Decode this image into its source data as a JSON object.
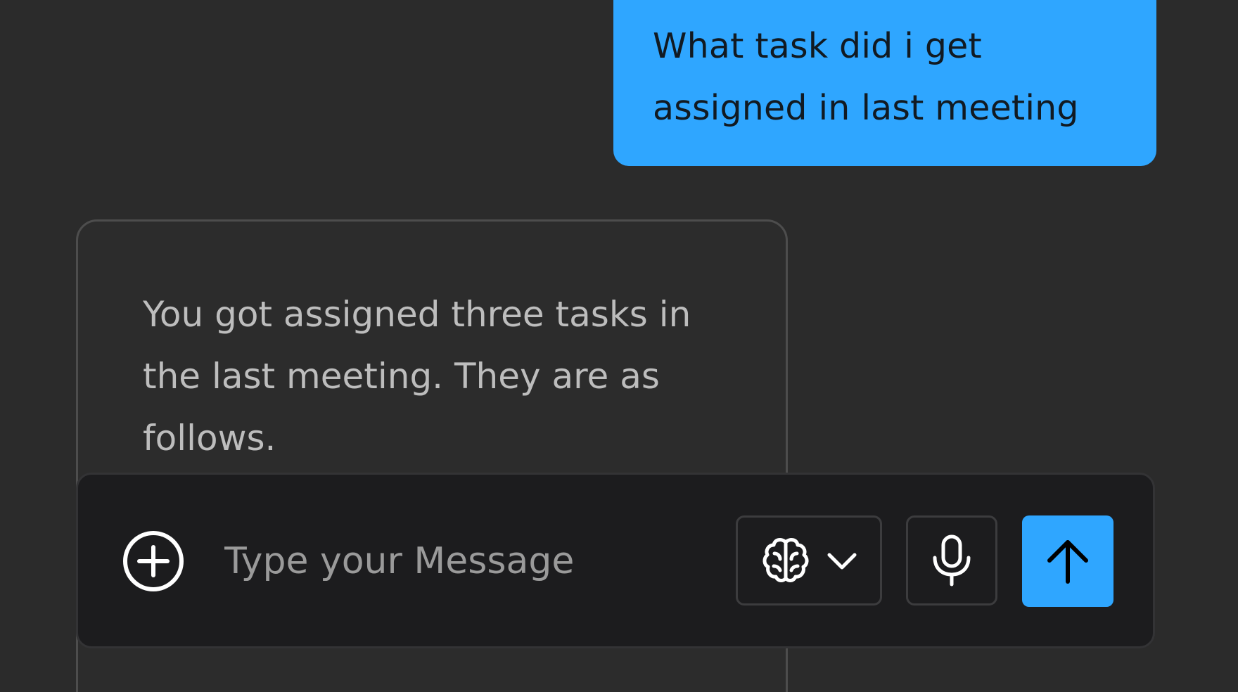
{
  "conversation": {
    "user_message": "What task did i get assigned in last meeting",
    "assistant_message": "You got assigned three tasks in the last meeting. They are as follows."
  },
  "composer": {
    "placeholder": "Type your Message",
    "value": "",
    "add_icon": "plus-circle-icon",
    "model_icon": "brain-icon",
    "dropdown_icon": "chevron-down-icon",
    "mic_icon": "microphone-icon",
    "send_icon": "arrow-up-icon"
  },
  "colors": {
    "background": "#2b2b2b",
    "accent": "#2fa6ff",
    "composer_bg": "#1c1c1e",
    "assistant_text": "#bdbdbd"
  }
}
